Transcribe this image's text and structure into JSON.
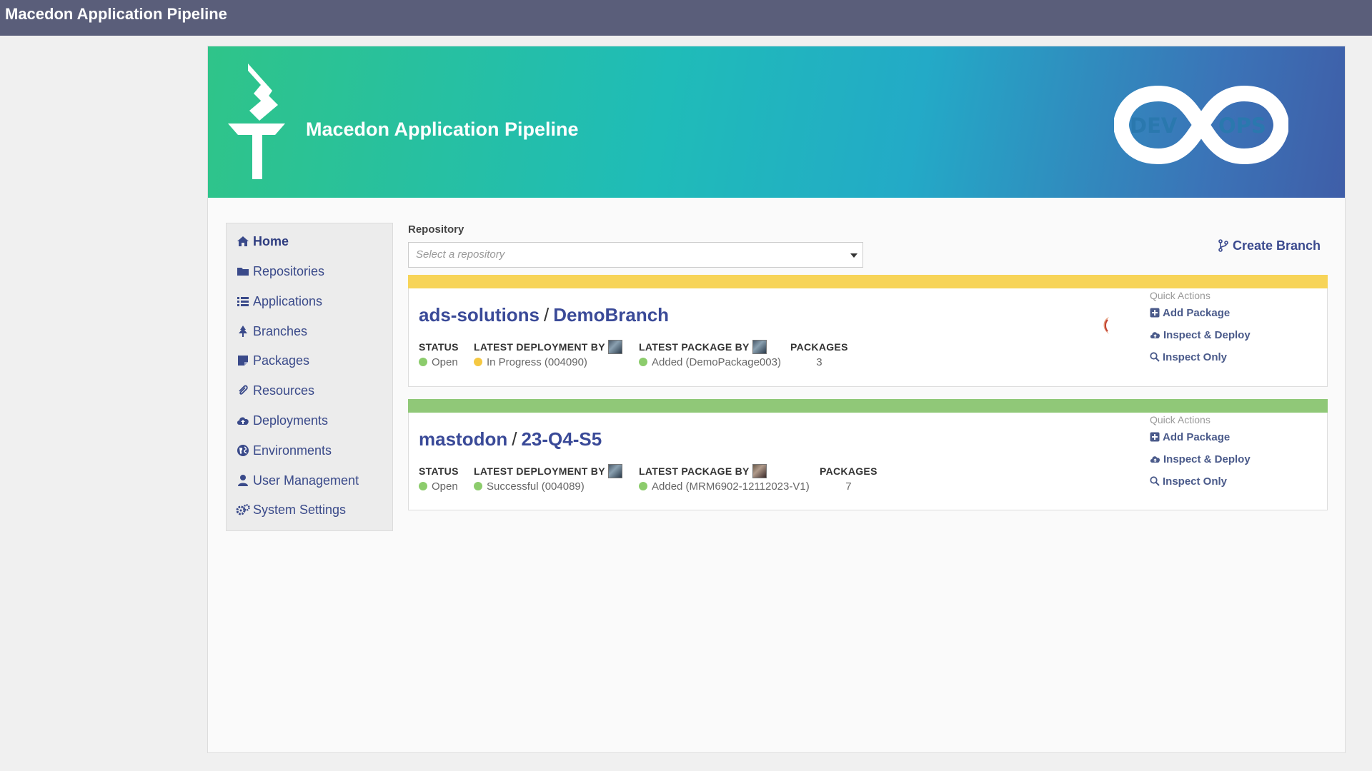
{
  "window": {
    "title": "Macedon Application Pipeline"
  },
  "banner": {
    "title": "Macedon Application Pipeline",
    "logo_left": "DEV",
    "logo_right": "OPS"
  },
  "sidebar": {
    "items": [
      {
        "label": "Home",
        "icon": "home-icon",
        "active": true
      },
      {
        "label": "Repositories",
        "icon": "folder-icon"
      },
      {
        "label": "Applications",
        "icon": "list-icon"
      },
      {
        "label": "Branches",
        "icon": "tree-icon"
      },
      {
        "label": "Packages",
        "icon": "package-icon"
      },
      {
        "label": "Resources",
        "icon": "paperclip-icon"
      },
      {
        "label": "Deployments",
        "icon": "cloud-icon"
      },
      {
        "label": "Environments",
        "icon": "globe-icon"
      },
      {
        "label": "User Management",
        "icon": "user-icon"
      },
      {
        "label": "System Settings",
        "icon": "cogs-icon"
      }
    ]
  },
  "repository": {
    "label": "Repository",
    "placeholder": "Select a repository"
  },
  "create_branch": {
    "label": "Create Branch"
  },
  "labels": {
    "status": "STATUS",
    "latest_deployment_by": "LATEST DEPLOYMENT BY",
    "latest_package_by": "LATEST PACKAGE BY",
    "packages": "PACKAGES",
    "quick_actions": "Quick Actions",
    "add_package": "Add Package",
    "inspect_deploy": "Inspect & Deploy",
    "inspect_only": "Inspect Only"
  },
  "branches": [
    {
      "repo": "ads-solutions",
      "separator": "/",
      "branch": "DemoBranch",
      "bar_color": "#f7d458",
      "status": "Open",
      "status_color": "#8ccc6c",
      "deployment": "In Progress (004090)",
      "deployment_color": "#f5c842",
      "package": "Added (DemoPackage003)",
      "package_color": "#8ccc6c",
      "packages": "3"
    },
    {
      "repo": "mastodon",
      "separator": "/",
      "branch": "23-Q4-S5",
      "bar_color": "#90c878",
      "status": "Open",
      "status_color": "#8ccc6c",
      "deployment": "Successful (004089)",
      "deployment_color": "#8ccc6c",
      "package": "Added (MRM6902-12112023-V1)",
      "package_color": "#8ccc6c",
      "packages": "7"
    }
  ]
}
